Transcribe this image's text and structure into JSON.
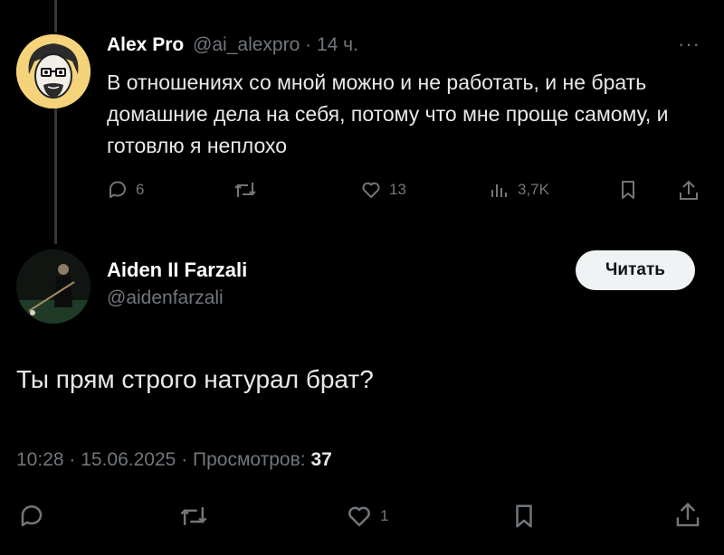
{
  "quoted_post": {
    "author_name": "Alex Pro",
    "handle": "@ai_alexpro",
    "separator": "·",
    "age": "14 ч.",
    "more": "···",
    "text": "В отношениях со мной можно и не работать, и не брать домашние дела на себя, потому что мне проще самому, и готовлю я неплохо",
    "replies": "6",
    "reposts": "",
    "likes": "13",
    "views": "3,7K"
  },
  "post": {
    "author_name": "Aiden II Farzali",
    "handle": "@aidenfarzali",
    "follow_label": "Читать",
    "text": "Ты прям строго натурал брат?",
    "time": "10:28",
    "date": "15.06.2025",
    "views_label": "Просмотров:",
    "views_count": "37",
    "likes": "1"
  },
  "icons": {
    "reply": "reply-icon",
    "repost": "repost-icon",
    "like": "heart-icon",
    "views": "views-icon",
    "bookmark": "bookmark-icon",
    "share": "share-icon",
    "more": "more-icon"
  },
  "colors": {
    "background": "#000000",
    "text": "#e7e9ea",
    "muted": "#71767b",
    "button_bg": "#eff3f4",
    "button_text": "#0f1419"
  }
}
